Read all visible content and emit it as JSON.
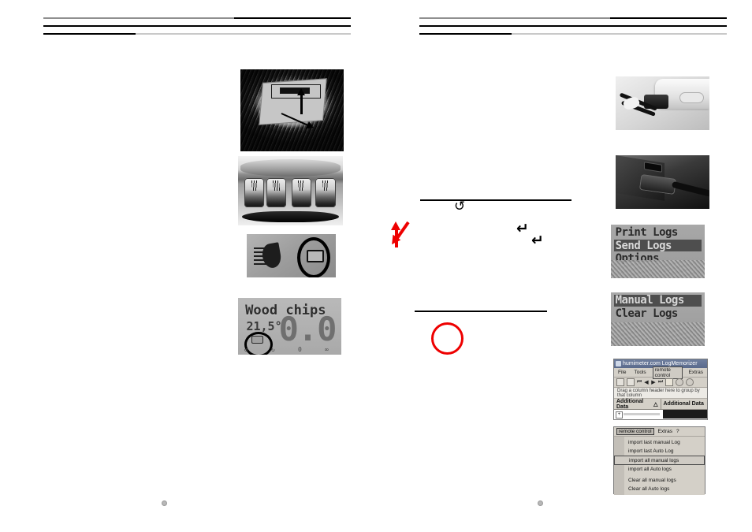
{
  "spread": {
    "left_page": {
      "header_rules": [
        {
          "segments": [
            {
              "color": "#8f8f8f",
              "width_pct": 62
            },
            {
              "color": "#000000",
              "width_pct": 38
            }
          ]
        },
        {
          "segments": [
            {
              "color": "#000000",
              "width_pct": 100
            }
          ]
        },
        {
          "segments": [
            {
              "color": "#000000",
              "width_pct": 30
            },
            {
              "color": "#c9c9c9",
              "width_pct": 70
            }
          ]
        }
      ],
      "figures": [
        {
          "name": "device-panel-photo",
          "caption_text": "",
          "kind": "photo"
        },
        {
          "name": "battery-compartment-photo",
          "caption_text": "",
          "kind": "photo"
        },
        {
          "name": "battery-indicator-icon-photo",
          "caption_text": "",
          "kind": "photo"
        },
        {
          "name": "lcd-measurement-photo",
          "caption_text": "",
          "kind": "photo"
        }
      ],
      "lcd": {
        "title": "Wood chips",
        "temperature": "21,5°",
        "value": "0.0",
        "footer_left": "↺",
        "footer_mid": "↻",
        "footer_value": "0",
        "footer_right": "∞"
      },
      "footer_mark": "⚙"
    },
    "right_page": {
      "header_rules": [
        {
          "segments": [
            {
              "color": "#8f8f8f",
              "width_pct": 62
            },
            {
              "color": "#000000",
              "width_pct": 38
            }
          ]
        },
        {
          "segments": [
            {
              "color": "#000000",
              "width_pct": 100
            }
          ]
        },
        {
          "segments": [
            {
              "color": "#000000",
              "width_pct": 30
            },
            {
              "color": "#c9c9c9",
              "width_pct": 70
            }
          ]
        }
      ],
      "symbols": {
        "refresh_glyph": "↺",
        "enter_glyph_1": "↵",
        "enter_glyph_2": "↵",
        "up_arrow_color": "#ee0000",
        "down_arrow_color": "#ee0000",
        "circle_color": "#ee0000"
      },
      "figures": [
        {
          "name": "usb-cable-to-device-photo",
          "kind": "photo"
        },
        {
          "name": "usb-cable-to-laptop-photo",
          "kind": "photo"
        },
        {
          "name": "lcd-menu-send-logs-photo",
          "kind": "lcd-menu"
        },
        {
          "name": "lcd-menu-manual-logs-photo",
          "kind": "lcd-menu"
        },
        {
          "name": "logmemorizer-window-screenshot",
          "kind": "screenshot"
        },
        {
          "name": "remote-control-dropdown-screenshot",
          "kind": "screenshot"
        }
      ],
      "lcd_menu_1": {
        "items": [
          {
            "label": "Print Logs",
            "selected": false
          },
          {
            "label": "Send Logs",
            "selected": true
          },
          {
            "label": "Options",
            "selected": false
          }
        ]
      },
      "lcd_menu_2": {
        "items": [
          {
            "label": "Manual Logs",
            "selected": true
          },
          {
            "label": "Clear Logs",
            "selected": false
          }
        ]
      },
      "software_window": {
        "title": "humimeter.com LogMemorizer",
        "menu": [
          {
            "label": "File",
            "active": false
          },
          {
            "label": "Tools",
            "active": false
          },
          {
            "label": "remote control",
            "active": true
          },
          {
            "label": "Extras",
            "active": false
          }
        ],
        "nav_buttons": [
          "⏮",
          "◀",
          "▶",
          "⏭"
        ],
        "group_hint": "Drag a column header here to group by that column",
        "columns": [
          "Additional Data",
          "Additional Data"
        ],
        "sort_indicator": "△",
        "expander": "+",
        "status": ""
      },
      "dropdown": {
        "menubar": [
          {
            "label": "remote control",
            "active": true
          },
          {
            "label": "Extras",
            "active": false
          },
          {
            "label": "?",
            "active": false
          }
        ],
        "items": [
          {
            "label": "import last manual Log",
            "selected": false
          },
          {
            "label": "import last Auto Log",
            "selected": false
          },
          {
            "label": "import all manual logs",
            "selected": true
          },
          {
            "label": "import all Auto logs",
            "selected": false
          },
          {
            "label": "Clear all manual logs",
            "selected": false
          },
          {
            "label": "Clear all Auto logs",
            "selected": false
          }
        ]
      },
      "footer_mark": "⚙"
    }
  }
}
